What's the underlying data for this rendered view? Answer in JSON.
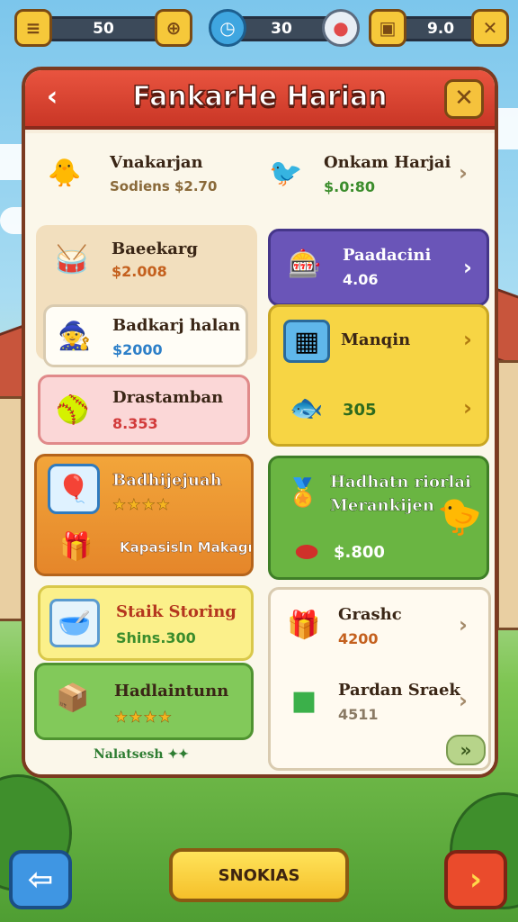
{
  "hud": {
    "coins": "50",
    "gems": "30",
    "gold": "9.0",
    "menu_icon": "menu-icon",
    "add_icon": "add-icon",
    "clock_icon": "clock-icon",
    "pin_icon": "pin-icon",
    "chest_icon": "chest-icon",
    "close_icon": "close-icon"
  },
  "panel": {
    "title": "FankarHe Harian",
    "back_label": "‹",
    "close_label": "✕"
  },
  "top_row": [
    {
      "title": "Vnakarjan",
      "sub": "Sodiens $2.70",
      "icon": "chick-icon"
    },
    {
      "title": "Onkam Harjai",
      "sub": "$.0:80",
      "icon": "bird-icon"
    }
  ],
  "left_items": [
    {
      "title": "Baeekarg",
      "sub": "$2.008",
      "icon": "drum-icon"
    },
    {
      "title": "Badkarj halan",
      "sub": "$2000",
      "icon": "hat-icon"
    },
    {
      "title": "Drastamban",
      "sub": "8.353",
      "icon": "ball-icon"
    }
  ],
  "left_featured": {
    "title": "Badhijejuah",
    "stars": "★★★★",
    "sub": "Kapasisln Makagn",
    "icon": "balloon-icon",
    "gift_icon": "gift-icon"
  },
  "left_bottom": [
    {
      "title": "Staik Storing",
      "sub": "Shins.300",
      "icon": "bowl-icon"
    },
    {
      "title": "Hadlaintunn",
      "stars": "★★★★",
      "icon": "crate-icon"
    }
  ],
  "left_footer": "Nalatsesh ✦✦",
  "right_items": [
    {
      "title": "Paadacini",
      "sub": "4.06",
      "icon": "machine-icon"
    },
    {
      "title": "Manqin",
      "icon": "box-icon"
    },
    {
      "title": "",
      "sub": "305",
      "icon": "creature-icon"
    }
  ],
  "right_featured": {
    "title": "Hadhatn riorlai",
    "title2": "Merankijen",
    "sub": "$.800",
    "icon": "badge-icon",
    "coin_icon": "coin-icon",
    "mascot_icon": "mascot-icon"
  },
  "right_bottom": [
    {
      "title": "Grashc",
      "sub": "4200",
      "icon": "present-icon"
    },
    {
      "title": "Pardan Sraek",
      "sub": "4511",
      "icon": "cube-icon"
    }
  ],
  "bottom": {
    "left_icon": "arrow-left-icon",
    "center_label": "SNOKIAS",
    "right_icon": "arrow-right-icon"
  },
  "colors": {
    "header": "#d8402f",
    "orange": "#ee9a2c",
    "green": "#6ab542",
    "purple": "#6a55b8",
    "yellow": "#f7d544"
  }
}
